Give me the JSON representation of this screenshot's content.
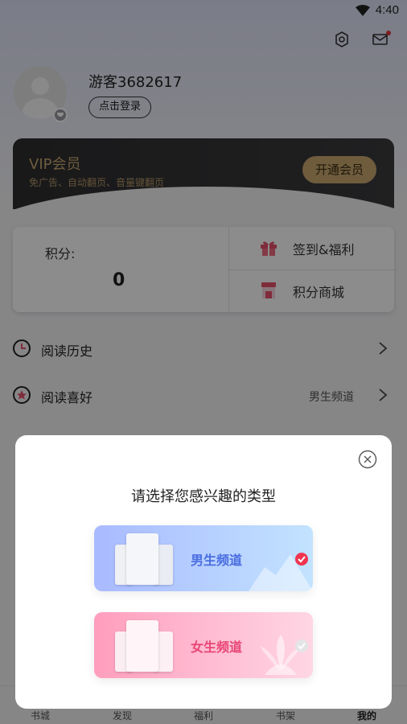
{
  "status_bar": {
    "time": "4:40"
  },
  "profile": {
    "username": "游客3682617",
    "login_button": "点击登录"
  },
  "vip": {
    "title": "VIP会员",
    "subtitle": "免广告、自动翻页、音量键翻页",
    "button": "开通会员"
  },
  "points": {
    "label": "积分:",
    "value": "0",
    "checkin": "签到&福利",
    "mall": "积分商城"
  },
  "menu": [
    {
      "label": "阅读历史",
      "value": ""
    },
    {
      "label": "阅读喜好",
      "value": "男生频道"
    }
  ],
  "bottom_nav": [
    "书城",
    "发现",
    "福利",
    "书架",
    "我的"
  ],
  "modal": {
    "title": "请选择您感兴趣的类型",
    "options": [
      {
        "label": "男生频道",
        "selected": true
      },
      {
        "label": "女生频道",
        "selected": false
      }
    ]
  },
  "colors": {
    "vip_gold": "#c9a870",
    "accent_red": "#f0344f",
    "male_blue": "#4a6ee0",
    "female_pink": "#e84777"
  }
}
